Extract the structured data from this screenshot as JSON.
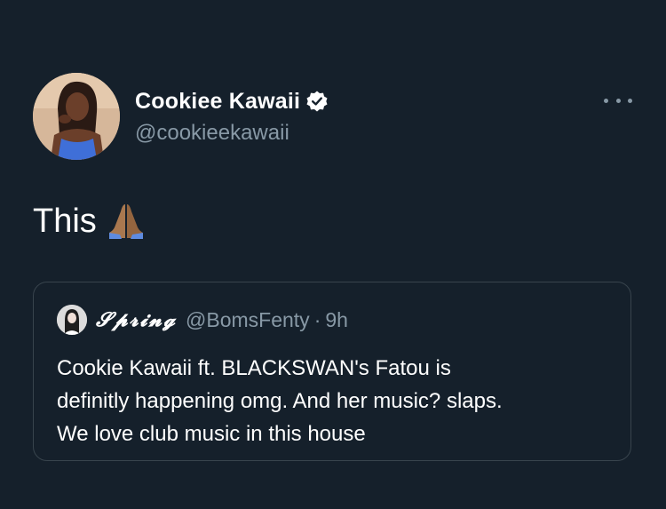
{
  "author": {
    "display_name": "Cookiee Kawaii",
    "handle": "@cookieekawaii",
    "verified": true,
    "avatar_icon": "profile-photo"
  },
  "tweet": {
    "text": "This",
    "emoji": "🙏"
  },
  "quoted_tweet": {
    "display_name": "𝓢𝓹𝓻𝓲𝓷𝓰",
    "handle": "@BomsFenty",
    "separator": "·",
    "time": "9h",
    "lines": [
      "Cookie Kawaii ft. BLACKSWAN's Fatou is",
      "definitly happening omg. And her music? slaps.",
      "We love club music in this house"
    ]
  },
  "colors": {
    "background": "#15202b",
    "secondary_text": "#8899a6",
    "border": "#38444d"
  }
}
